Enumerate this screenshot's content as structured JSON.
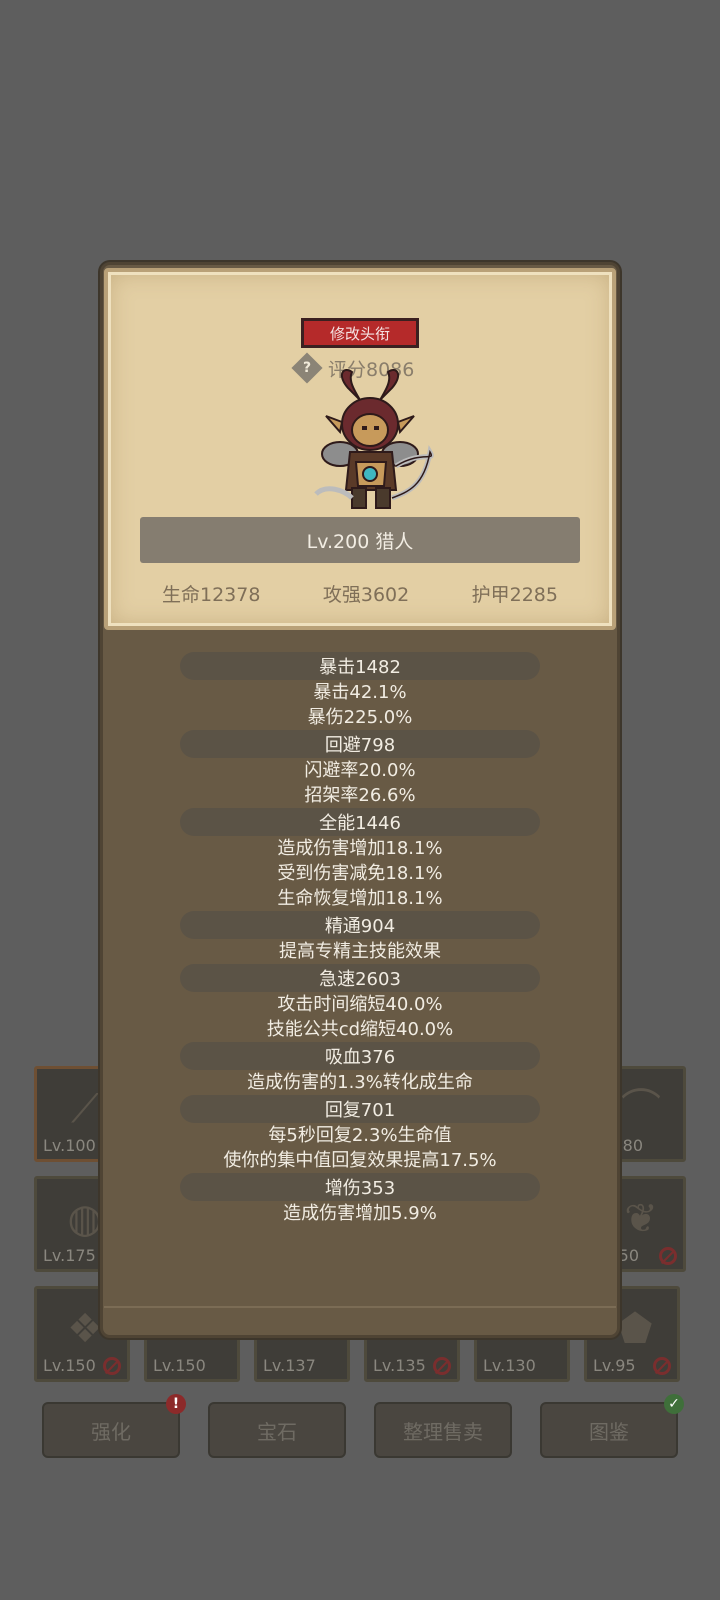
{
  "header": {
    "edit_title_label": "修改头衔",
    "score_text": "评分8086",
    "help_icon": "question-diamond-icon"
  },
  "character": {
    "level_class": "Lv.200 猎人",
    "hp": "生命12378",
    "attack": "攻强3602",
    "armor": "护甲2285"
  },
  "stats": [
    {
      "head": "暴击1482",
      "lines": [
        "暴击42.1%",
        "暴伤225.0%"
      ]
    },
    {
      "head": "回避798",
      "lines": [
        "闪避率20.0%",
        "招架率26.6%"
      ]
    },
    {
      "head": "全能1446",
      "lines": [
        "造成伤害增加18.1%",
        "受到伤害减免18.1%",
        "生命恢复增加18.1%"
      ]
    },
    {
      "head": "精通904",
      "lines": [
        "提高专精主技能效果"
      ]
    },
    {
      "head": "急速2603",
      "lines": [
        "攻击时间缩短40.0%",
        "技能公共cd缩短40.0%"
      ]
    },
    {
      "head": "吸血376",
      "lines": [
        "造成伤害的1.3%转化成生命"
      ]
    },
    {
      "head": "回复701",
      "lines": [
        "每5秒回复2.3%生命值",
        "使你的集中值回复效果提高17.5%"
      ]
    },
    {
      "head": "增伤353",
      "lines": [
        "造成伤害增加5.9%"
      ]
    }
  ],
  "inventory": {
    "row1": [
      {
        "lv": "Lv.100"
      },
      {
        "lv": "80"
      }
    ],
    "row2": [
      {
        "lv": "Lv.175"
      },
      {
        "lv": "50"
      }
    ],
    "row3": [
      {
        "lv": "Lv.150"
      },
      {
        "lv": "Lv.150"
      },
      {
        "lv": "Lv.137"
      },
      {
        "lv": "Lv.135"
      },
      {
        "lv": "Lv.130"
      },
      {
        "lv": "Lv.95"
      }
    ]
  },
  "buttons": {
    "enhance": "强化",
    "gem": "宝石",
    "sort_sell": "整理售卖",
    "codex": "图鉴",
    "alert_mark": "!",
    "check_mark": "✓"
  }
}
